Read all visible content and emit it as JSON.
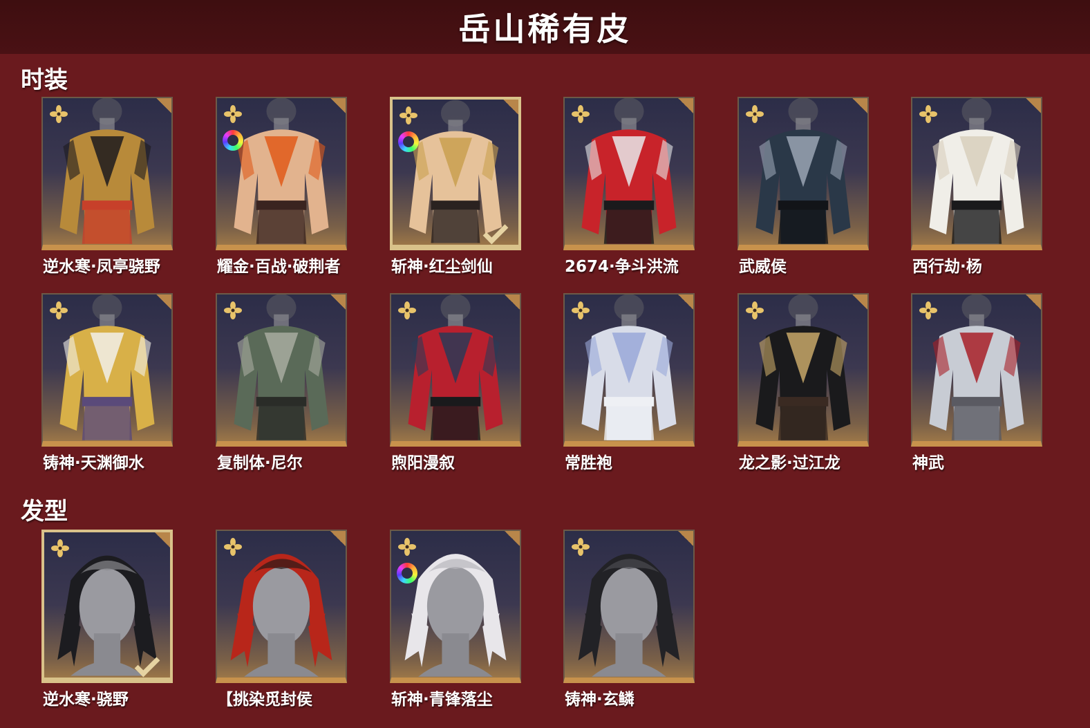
{
  "page_title": "岳山稀有皮",
  "sections": {
    "costume": {
      "title": "时装",
      "items": [
        {
          "name": "逆水寒·凤亭骁野",
          "palette": [
            "#b88a3a",
            "#1c1a1e",
            "#c7402a"
          ],
          "rainbow": false,
          "selected": false
        },
        {
          "name": "耀金·百战·破荆者",
          "palette": [
            "#e2b38e",
            "#e05a1a",
            "#3a2420"
          ],
          "rainbow": true,
          "selected": false
        },
        {
          "name": "斩神·红尘剑仙",
          "palette": [
            "#e6c29a",
            "#c9a050",
            "#2a2220"
          ],
          "rainbow": true,
          "selected": true
        },
        {
          "name": "2674·争斗洪流",
          "palette": [
            "#c8232a",
            "#e8e8ea",
            "#1a1a1c"
          ],
          "rainbow": false,
          "selected": false
        },
        {
          "name": "武威侯",
          "palette": [
            "#2a3848",
            "#9aa4b4",
            "#121418"
          ],
          "rainbow": false,
          "selected": false
        },
        {
          "name": "西行劫·杨",
          "palette": [
            "#f0eee8",
            "#d8cfbc",
            "#1a1a1c"
          ],
          "rainbow": false,
          "selected": false
        },
        {
          "name": "铸神·天渊御水",
          "palette": [
            "#d8b048",
            "#f2f0ea",
            "#5a4a7a"
          ],
          "rainbow": false,
          "selected": false
        },
        {
          "name": "复制体·尼尔",
          "palette": [
            "#5a6a58",
            "#a8aca0",
            "#2a2c28"
          ],
          "rainbow": false,
          "selected": false
        },
        {
          "name": "煦阳漫叙",
          "palette": [
            "#b8202e",
            "#2c3a56",
            "#1a1a1c"
          ],
          "rainbow": false,
          "selected": false
        },
        {
          "name": "常胜袍",
          "palette": [
            "#d8dce8",
            "#9aa8d8",
            "#eef0f4"
          ],
          "rainbow": false,
          "selected": false
        },
        {
          "name": "龙之影·过江龙",
          "palette": [
            "#1a1a1c",
            "#c8a868",
            "#3a2a22"
          ],
          "rainbow": false,
          "selected": false
        },
        {
          "name": "神武",
          "palette": [
            "#c8ccd4",
            "#a82028",
            "#5a5a62"
          ],
          "rainbow": false,
          "selected": false
        }
      ]
    },
    "hairstyle": {
      "title": "发型",
      "items": [
        {
          "name": "逆水寒·骁野",
          "palette": [
            "#1c1c20",
            "#8a8a8e"
          ],
          "rainbow": false,
          "selected": true
        },
        {
          "name": "【挑染觅封侯",
          "palette": [
            "#b8261a",
            "#2a1a18"
          ],
          "rainbow": false,
          "selected": false
        },
        {
          "name": "斩神·青锋落尘",
          "palette": [
            "#e8e6ea",
            "#b8b6bc"
          ],
          "rainbow": true,
          "selected": false
        },
        {
          "name": "铸神·玄鳞",
          "palette": [
            "#222226",
            "#4a4a50"
          ],
          "rainbow": false,
          "selected": false
        }
      ]
    }
  },
  "colors": {
    "background": "#6a1a1e",
    "title_bar": "#3e0e10",
    "card_border_gold": "#c8924c",
    "selected_border": "#d9c28a"
  }
}
